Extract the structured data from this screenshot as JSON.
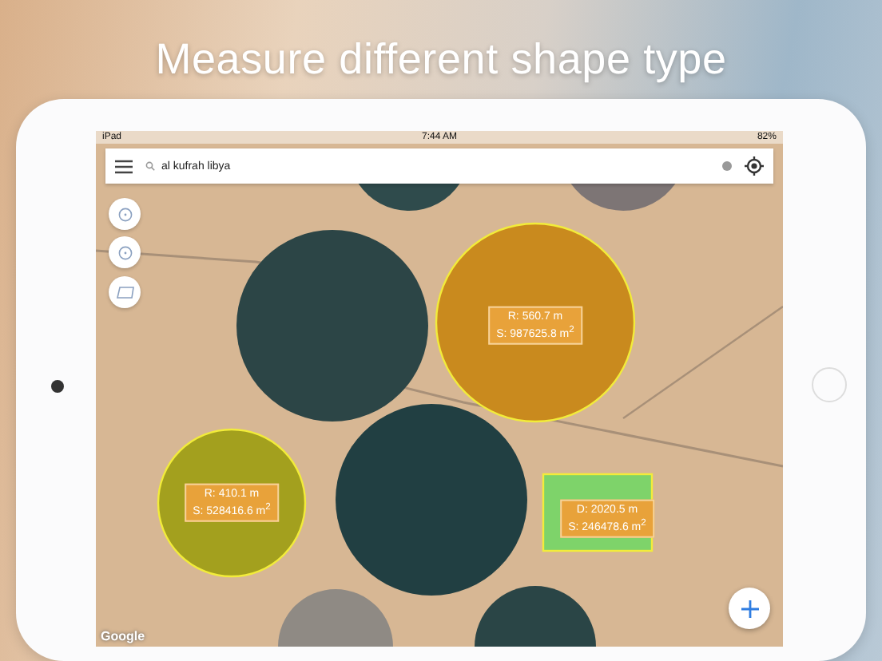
{
  "headline": "Measure different shape type",
  "status_bar": {
    "carrier": "iPad",
    "time": "7:44 AM",
    "battery": "82%"
  },
  "search": {
    "value": "al kufrah libya"
  },
  "shapes": [
    {
      "kind": "circle",
      "color": "#c98a1e",
      "lines": [
        "R: 560.7 m",
        "S: 987625.8 m$^{2}$"
      ]
    },
    {
      "kind": "circle",
      "color": "#a3a01e",
      "lines": [
        "R: 410.1 m",
        "S: 528416.6 m$^{2}$"
      ]
    },
    {
      "kind": "rectangle",
      "color": "#7ed36a",
      "lines": [
        "D: 2020.5 m",
        "S: 246478.6 m$^{2}$"
      ]
    }
  ],
  "map_attribution": "Google"
}
